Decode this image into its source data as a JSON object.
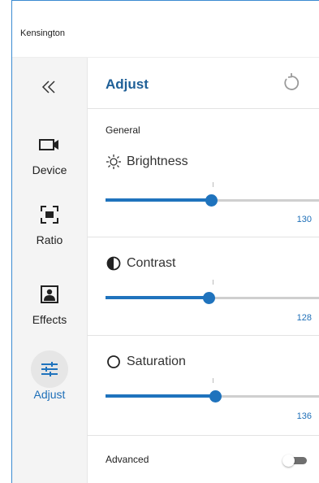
{
  "app": {
    "title": "Kensington"
  },
  "sidebar": {
    "items": [
      {
        "label": "Device",
        "icon": "camera-icon"
      },
      {
        "label": "Ratio",
        "icon": "frame-icon"
      },
      {
        "label": "Effects",
        "icon": "portrait-icon"
      },
      {
        "label": "Adjust",
        "icon": "sliders-icon",
        "active": true
      }
    ]
  },
  "panel": {
    "title": "Adjust",
    "general_label": "General",
    "controls": [
      {
        "name": "Brightness",
        "icon": "sun-icon",
        "value": "130",
        "level": 0.49
      },
      {
        "name": "Contrast",
        "icon": "contrast-icon",
        "value": "128",
        "level": 0.48
      },
      {
        "name": "Saturation",
        "icon": "circle-outline-icon",
        "value": "136",
        "level": 0.51
      }
    ],
    "advanced_label": "Advanced",
    "advanced_enabled": false
  },
  "colors": {
    "accent": "#1f73bd",
    "title": "#1e5f97"
  }
}
